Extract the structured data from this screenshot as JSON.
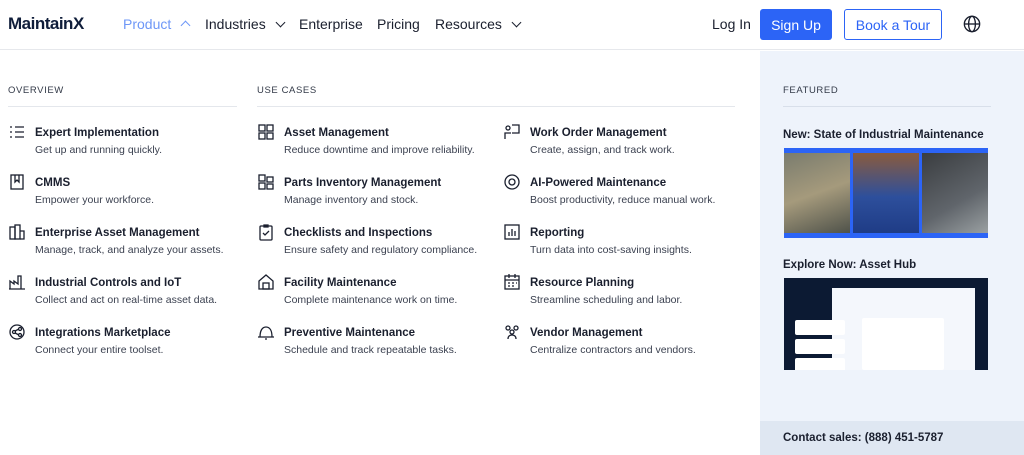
{
  "header": {
    "logo": "MaintainX",
    "nav": [
      {
        "label": "Product",
        "active": true,
        "chevron": "chevron-up-icon"
      },
      {
        "label": "Industries",
        "chevron": "chevron-down-icon"
      },
      {
        "label": "Enterprise"
      },
      {
        "label": "Pricing"
      },
      {
        "label": "Resources",
        "chevron": "chevron-down-icon"
      }
    ],
    "login": "Log In",
    "signup": "Sign Up",
    "tour": "Book a Tour",
    "globe_icon": "globe-icon",
    "accent": "#2c64f6"
  },
  "overview": {
    "heading": "OVERVIEW",
    "items": [
      {
        "title": "Expert Implementation",
        "desc": "Get up and running quickly.",
        "icon": "checklist-icon"
      },
      {
        "title": "CMMS",
        "desc": "Empower your workforce.",
        "icon": "bookmark-book-icon"
      },
      {
        "title": "Enterprise Asset Management",
        "desc": "Manage, track, and analyze your assets.",
        "icon": "building-icon"
      },
      {
        "title": "Industrial Controls and IoT",
        "desc": "Collect and act on real-time asset data.",
        "icon": "factory-icon"
      },
      {
        "title": "Integrations Marketplace",
        "desc": "Connect your entire toolset.",
        "icon": "share-nodes-icon"
      }
    ]
  },
  "use_cases": {
    "heading": "USE CASES",
    "items": [
      {
        "title": "Asset Management",
        "desc": "Reduce downtime and improve reliability.",
        "icon": "grid-icon"
      },
      {
        "title": "Parts Inventory Management",
        "desc": "Manage inventory and stock.",
        "icon": "boxes-icon"
      },
      {
        "title": "Checklists and Inspections",
        "desc": "Ensure safety and regulatory compliance.",
        "icon": "clipboard-check-icon"
      },
      {
        "title": "Facility Maintenance",
        "desc": "Complete maintenance work on time.",
        "icon": "house-icon"
      },
      {
        "title": "Preventive Maintenance",
        "desc": "Schedule and track repeatable tasks.",
        "icon": "alarm-icon"
      },
      {
        "title": "Work Order Management",
        "desc": "Create, assign, and track work.",
        "icon": "worker-board-icon"
      },
      {
        "title": "AI-Powered Maintenance",
        "desc": "Boost productivity, reduce manual work.",
        "icon": "ai-gear-icon"
      },
      {
        "title": "Reporting",
        "desc": "Turn data into cost-saving insights.",
        "icon": "bar-chart-icon"
      },
      {
        "title": "Resource Planning",
        "desc": "Streamline scheduling and labor.",
        "icon": "calendar-icon"
      },
      {
        "title": "Vendor Management",
        "desc": "Centralize contractors and vendors.",
        "icon": "people-icon"
      }
    ]
  },
  "featured": {
    "heading": "FEATURED",
    "items": [
      {
        "title": "New: State of Industrial Maintenance"
      },
      {
        "title": "Explore Now: Asset Hub"
      }
    ],
    "contact": "Contact sales: (888) 451-5787"
  }
}
